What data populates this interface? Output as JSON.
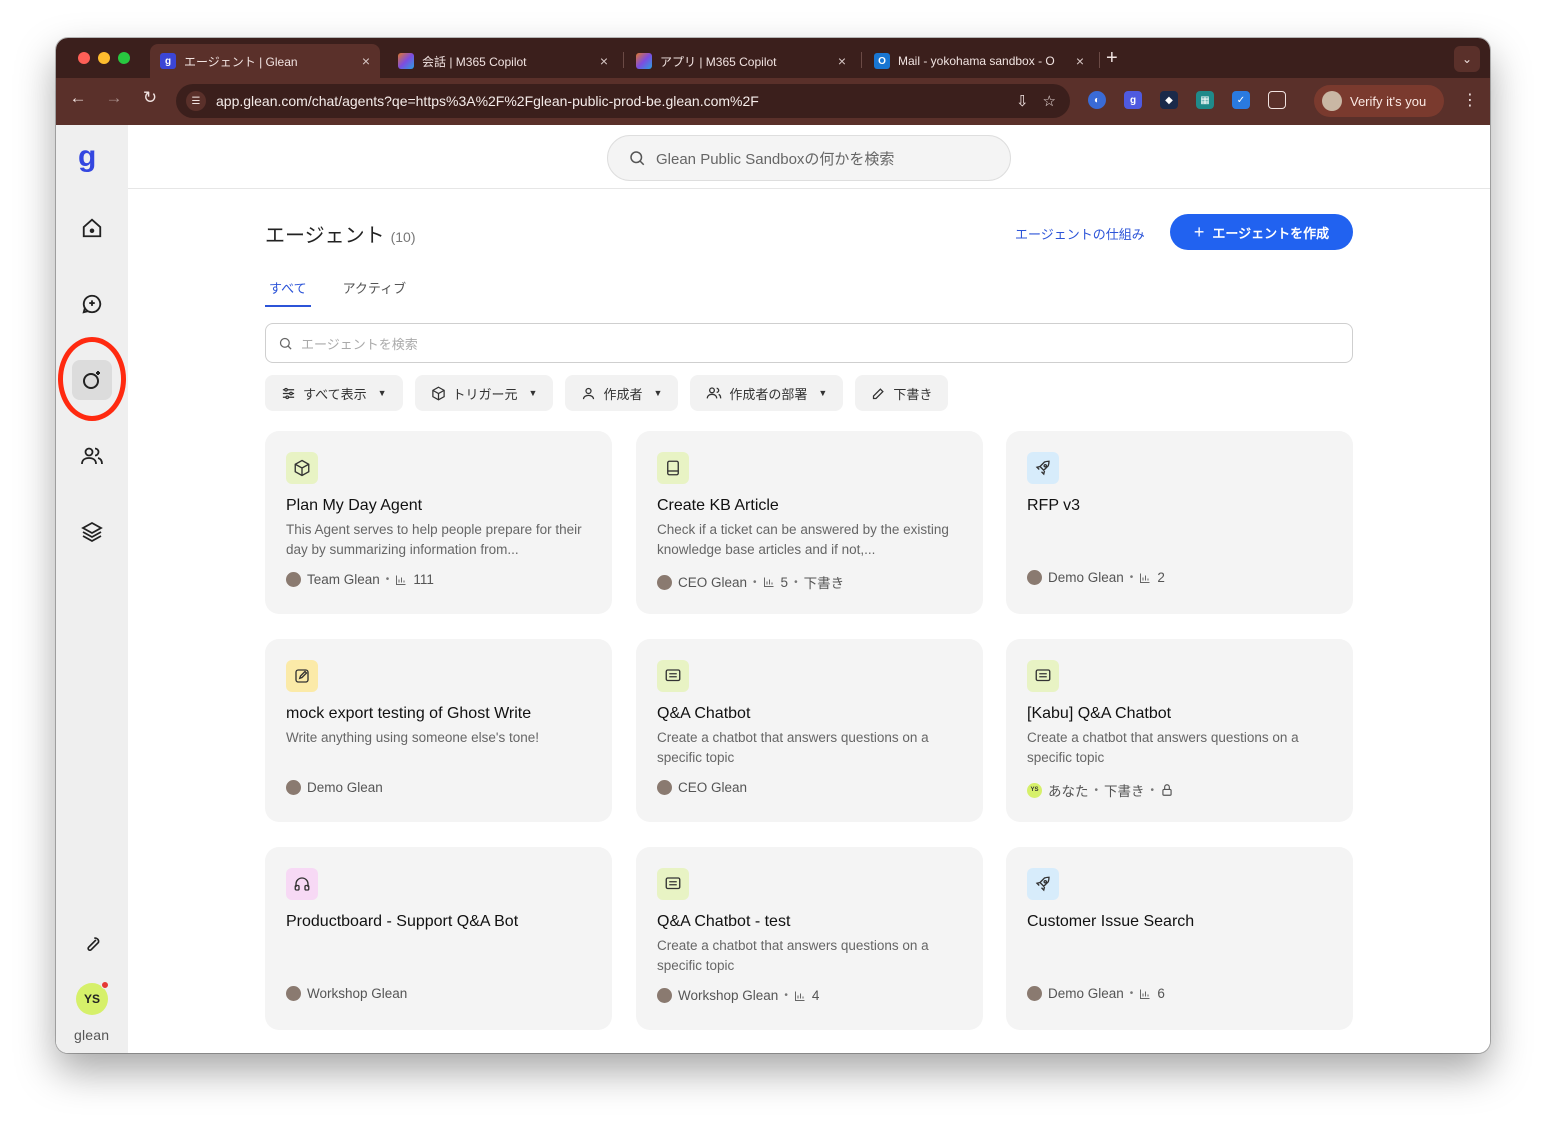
{
  "browser": {
    "tabs": [
      {
        "label": "エージェント | Glean",
        "favicon": "g",
        "favicon_color": "#3b46d6"
      },
      {
        "label": "会話 | M365 Copilot",
        "favicon": "",
        "favicon_color": "#e0782a"
      },
      {
        "label": "アプリ | M365 Copilot",
        "favicon": "",
        "favicon_color": "#e0782a"
      },
      {
        "label": "Mail - yokohama sandbox - O",
        "favicon": "O",
        "favicon_color": "#1976d2"
      }
    ],
    "url": "app.glean.com/chat/agents?qe=https%3A%2F%2Fglean-public-prod-be.glean.com%2F",
    "profile_label": "Verify it's you"
  },
  "app": {
    "brand_color": "#3447e0",
    "logo_letter": "g",
    "wordmark": "glean",
    "user_initials": "YS",
    "global_search_placeholder": "Glean Public Sandboxの何かを検索"
  },
  "header": {
    "title": "エージェント",
    "count": "(10)",
    "how_link": "エージェントの仕組み",
    "create_button": "エージェントを作成",
    "create_plus": "+"
  },
  "tabs": [
    {
      "label": "すべて",
      "active": true
    },
    {
      "label": "アクティブ",
      "active": false
    }
  ],
  "search": {
    "placeholder": "エージェントを検索"
  },
  "filters": [
    {
      "label": "すべて表示",
      "icon": "sliders-icon",
      "caret": true
    },
    {
      "label": "トリガー元",
      "icon": "cube-icon",
      "caret": true
    },
    {
      "label": "作成者",
      "icon": "user-icon",
      "caret": true
    },
    {
      "label": "作成者の部署",
      "icon": "users-icon",
      "caret": true
    },
    {
      "label": "下書き",
      "icon": "pencil-icon",
      "caret": false
    }
  ],
  "agents": [
    {
      "title": "Plan My Day Agent",
      "desc": "This Agent serves to help people prepare for their day by summarizing information from...",
      "icon": "cube-icon",
      "icon_bg": "#e8f3c4",
      "author": "Team Glean",
      "runs": "111",
      "draft": "",
      "locked": false
    },
    {
      "title": "Create KB Article",
      "desc": "Check if a ticket can be answered by the existing knowledge base articles and if not,...",
      "icon": "book-icon",
      "icon_bg": "#e8f3c4",
      "author": "CEO Glean",
      "runs": "5",
      "draft": "下書き",
      "locked": false
    },
    {
      "title": "RFP v3",
      "desc": "",
      "icon": "rocket-icon",
      "icon_bg": "#d7ecfb",
      "author": "Demo Glean",
      "runs": "2",
      "draft": "",
      "locked": false
    },
    {
      "title": "mock export testing of Ghost Write",
      "desc": "Write anything using someone else's tone!",
      "icon": "edit-icon",
      "icon_bg": "#fbeaa8",
      "author": "Demo Glean",
      "runs": "",
      "draft": "",
      "locked": false
    },
    {
      "title": "Q&A Chatbot",
      "desc": "Create a chatbot that answers questions on a specific topic",
      "icon": "chat-icon",
      "icon_bg": "#e8f3c4",
      "author": "CEO Glean",
      "runs": "",
      "draft": "",
      "locked": false
    },
    {
      "title": "[Kabu] Q&A Chatbot",
      "desc": "Create a chatbot that answers questions on a specific topic",
      "icon": "chat-icon",
      "icon_bg": "#e8f3c4",
      "author": "あなた",
      "runs": "",
      "draft": "下書き",
      "locked": true
    },
    {
      "title": "Productboard - Support Q&A Bot",
      "desc": "",
      "icon": "headphones-icon",
      "icon_bg": "#f7d9f5",
      "author": "Workshop Glean",
      "runs": "",
      "draft": "",
      "locked": false
    },
    {
      "title": "Q&A Chatbot - test",
      "desc": "Create a chatbot that answers questions on a specific topic",
      "icon": "chat-icon",
      "icon_bg": "#e8f3c4",
      "author": "Workshop Glean",
      "runs": "4",
      "draft": "",
      "locked": false
    },
    {
      "title": "Customer Issue Search",
      "desc": "",
      "icon": "rocket-icon",
      "icon_bg": "#d7ecfb",
      "author": "Demo Glean",
      "runs": "6",
      "draft": "",
      "locked": false
    }
  ]
}
